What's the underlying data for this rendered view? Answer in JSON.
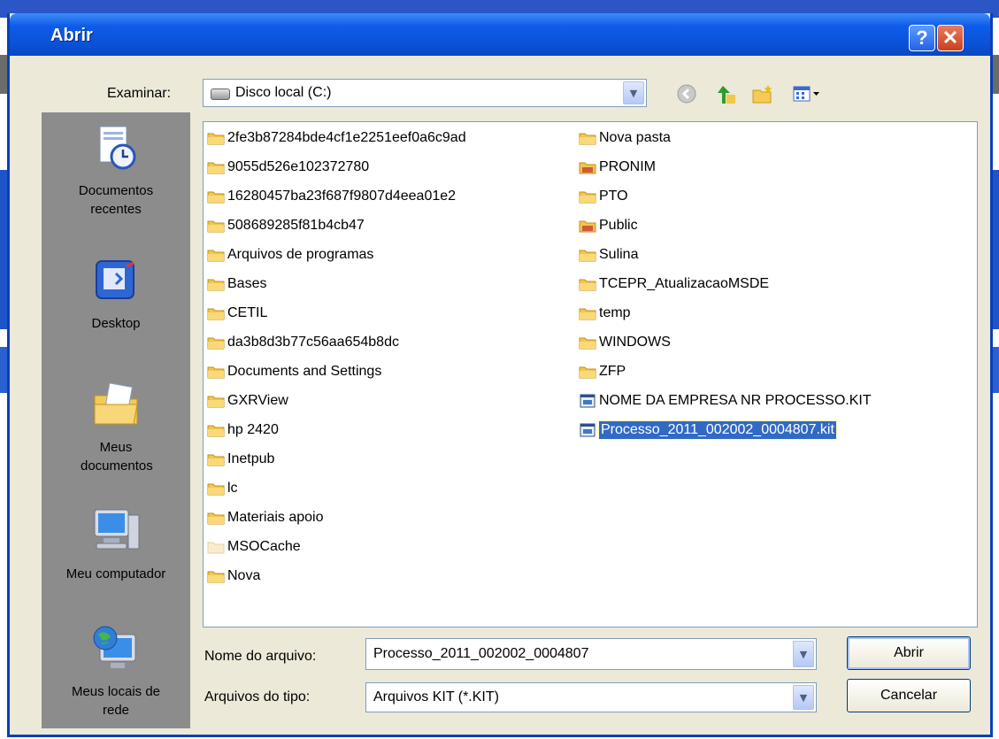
{
  "dialog": {
    "title": "Abrir",
    "help_label": "?",
    "close_label": "✕"
  },
  "lookin": {
    "label": "Examinar:",
    "value": "Disco local (C:)"
  },
  "places": [
    {
      "label": "Documentos recentes",
      "icon": "recent-documents-icon"
    },
    {
      "label": "Desktop",
      "icon": "desktop-icon"
    },
    {
      "label": "Meus documentos",
      "icon": "my-documents-icon"
    },
    {
      "label": "Meu computador",
      "icon": "my-computer-icon"
    },
    {
      "label": "Meus locais de rede",
      "icon": "network-places-icon"
    }
  ],
  "files_col1": [
    "2fe3b87284bde4cf1e2251eef0a6c9ad",
    "9055d526e102372780",
    "16280457ba23f687f9807d4eea01e2",
    "508689285f81b4cb47",
    "Arquivos de programas",
    "Bases",
    "CETIL",
    "da3b8d3b77c56aa654b8dc",
    "Documents and Settings",
    "GXRView",
    "hp 2420",
    "Inetpub",
    "lc",
    "Materiais apoio",
    "MSOCache",
    "Nova"
  ],
  "files_col2": [
    "Nova pasta",
    "PRONIM",
    "PTO",
    "Public",
    "Sulina",
    "TCEPR_AtualizacaoMSDE",
    "temp",
    "WINDOWS",
    "ZFP",
    "NOME DA EMPRESA NR PROCESSO.KIT",
    "Processo_2011_002002_0004807.kit"
  ],
  "filename": {
    "label": "Nome do arquivo:",
    "value": "Processo_2011_002002_0004807"
  },
  "filetype": {
    "label": "Arquivos do tipo:",
    "value": "Arquivos KIT (*.KIT)"
  },
  "buttons": {
    "open": "Abrir",
    "cancel": "Cancelar"
  },
  "colors": {
    "accent": "#0a53d8",
    "selection": "#316ac5",
    "dialog_bg": "#ece9d8"
  }
}
